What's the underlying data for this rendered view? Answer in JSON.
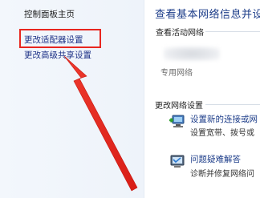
{
  "sidebar": {
    "home_label": "控制面板主页",
    "adapter_settings_label": "更改适配器设置",
    "advanced_sharing_label": "更改高级共享设置"
  },
  "main": {
    "title": "查看基本网络信息并设",
    "active_networks_label": "查看活动网络",
    "network_type": "专用网络",
    "change_settings_label": "更改网络设置",
    "tasks": [
      {
        "link": "设置新的连接或网",
        "desc": "设置宽带、拨号或"
      },
      {
        "link": "问题疑难解答",
        "desc": "诊断并修复网络问"
      }
    ]
  },
  "annotation": {
    "color": "#e8261f"
  }
}
